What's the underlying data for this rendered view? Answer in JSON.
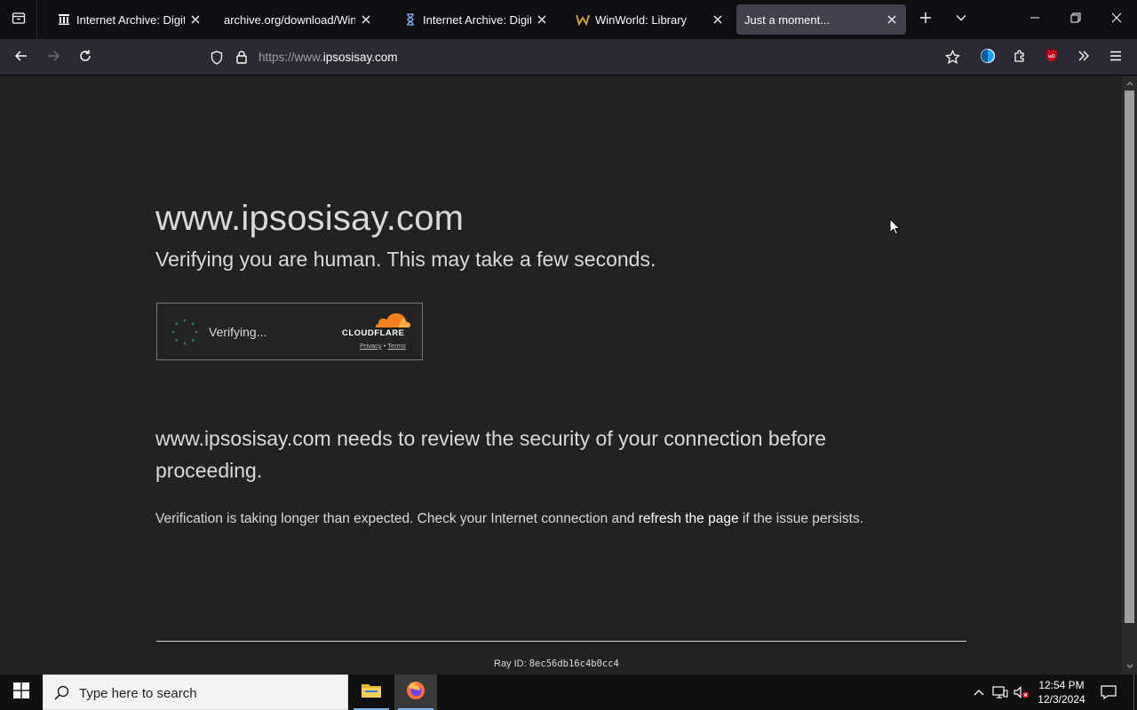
{
  "browser": {
    "tabs": [
      {
        "title": "Internet Archive: Digital Library",
        "favicon": "archive-building-icon",
        "active": false
      },
      {
        "title": "archive.org/download/WinXP",
        "favicon": "",
        "active": false
      },
      {
        "title": "Internet Archive: Digital Library",
        "favicon": "hourglass-icon",
        "active": false
      },
      {
        "title": "WinWorld: Library",
        "favicon": "winworld-w-icon",
        "active": false
      },
      {
        "title": "Just a moment...",
        "favicon": "",
        "active": true
      }
    ],
    "url": {
      "scheme": "https://www.",
      "host": "ipsosisay.com"
    }
  },
  "page": {
    "title": "www.ipsosisay.com",
    "subtitle": "Verifying you are human. This may take a few seconds.",
    "widget": {
      "status": "Verifying...",
      "brand": "CLOUDFLARE",
      "privacy": "Privacy",
      "separator": "•",
      "terms": "Terms"
    },
    "notice": "www.ipsosisay.com needs to review the security of your connection before proceeding.",
    "longer_pre": "Verification is taking longer than expected. Check your Internet connection and ",
    "refresh_link": "refresh the page",
    "longer_post": " if the issue persists.",
    "ray_label": "Ray ID: ",
    "ray_id": "8ec56db16c4b0cc4"
  },
  "taskbar": {
    "search_placeholder": "Type here to search",
    "time": "12:54 PM",
    "date": "12/3/2024"
  },
  "colors": {
    "cloudflare_orange": "#f38020",
    "spinner_green": "#2e7d4f",
    "active_tab": "#42414d"
  }
}
